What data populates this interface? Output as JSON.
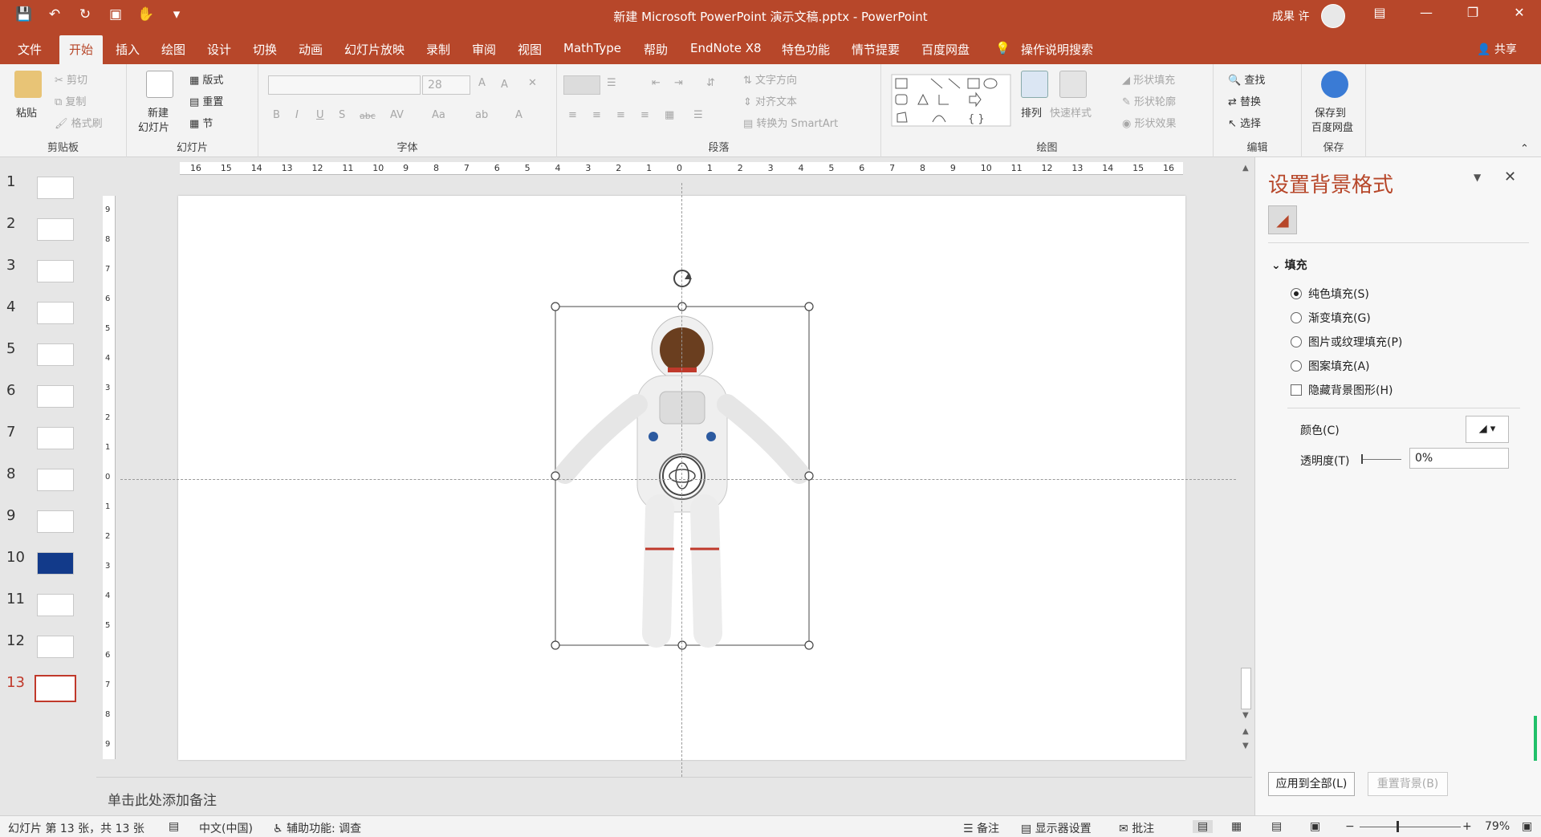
{
  "window": {
    "title": "新建 Microsoft PowerPoint 演示文稿.pptx  -  PowerPoint",
    "user": "成果 许",
    "titlebar_color": "#b7472a"
  },
  "qat": {
    "icons": [
      "save-icon",
      "undo-icon",
      "redo-icon",
      "present-icon",
      "touch-mode-icon",
      "customize-icon"
    ]
  },
  "tabs": [
    "文件",
    "开始",
    "插入",
    "绘图",
    "设计",
    "切换",
    "动画",
    "幻灯片放映",
    "录制",
    "审阅",
    "视图",
    "MathType",
    "帮助",
    "EndNote X8",
    "特色功能",
    "情节提要",
    "百度网盘",
    "操作说明搜索"
  ],
  "active_tab": "开始",
  "share_label": "共享",
  "ribbon": {
    "clipboard": {
      "paste": "粘贴",
      "cut": "剪切",
      "copy": "复制",
      "format_painter": "格式刷",
      "group": "剪贴板"
    },
    "slides": {
      "new_slide": "新建",
      "new_slide2": "幻灯片",
      "layout": "版式",
      "reset": "重置",
      "section": "节",
      "group": "幻灯片"
    },
    "font": {
      "font_name": "",
      "font_size": "28",
      "group": "字体",
      "bold": "B",
      "italic": "I",
      "underline": "U",
      "shadow": "S",
      "strike": "abc",
      "spacing": "AV",
      "case": "Aa",
      "color": "A",
      "grow": "A",
      "shrink": "A"
    },
    "paragraph": {
      "text_direction": "文字方向",
      "align_text": "对齐文本",
      "smartart": "转换为 SmartArt",
      "group": "段落"
    },
    "drawing": {
      "arrange": "排列",
      "quick_styles": "快速样式",
      "shape_fill": "形状填充",
      "shape_outline": "形状轮廓",
      "shape_effects": "形状效果",
      "group": "绘图"
    },
    "editing": {
      "find": "查找",
      "replace": "替换",
      "select": "选择",
      "group": "编辑"
    },
    "save": {
      "save_to": "保存到",
      "baidu": "百度网盘",
      "group": "保存"
    }
  },
  "slides": {
    "numbers": [
      "1",
      "2",
      "3",
      "4",
      "5",
      "6",
      "7",
      "8",
      "9",
      "10",
      "11",
      "12",
      "13"
    ],
    "selected": "13"
  },
  "ruler": {
    "h_labels": [
      "16",
      "15",
      "14",
      "13",
      "12",
      "11",
      "10",
      "9",
      "8",
      "7",
      "6",
      "5",
      "4",
      "3",
      "2",
      "1",
      "0",
      "1",
      "2",
      "3",
      "4",
      "5",
      "6",
      "7",
      "8",
      "9",
      "10",
      "11",
      "12",
      "13",
      "14",
      "15",
      "16"
    ],
    "v_labels": [
      "9",
      "8",
      "7",
      "6",
      "5",
      "4",
      "3",
      "2",
      "1",
      "0",
      "1",
      "2",
      "3",
      "4",
      "5",
      "6",
      "7",
      "8",
      "9"
    ]
  },
  "notes_placeholder": "单击此处添加备注",
  "format_pane": {
    "title": "设置背景格式",
    "section": "填充",
    "options": [
      "纯色填充(S)",
      "渐变填充(G)",
      "图片或纹理填充(P)",
      "图案填充(A)"
    ],
    "selected_option": "纯色填充(S)",
    "hide_bg_graphics": "隐藏背景图形(H)",
    "color_label": "颜色(C)",
    "transparency_label": "透明度(T)",
    "transparency_value": "0%",
    "apply_all": "应用到全部(L)",
    "reset_bg": "重置背景(B)"
  },
  "status": {
    "slide_info": "幻灯片 第 13 张，共 13 张",
    "language": "中文(中国)",
    "accessibility": "辅助功能: 调查",
    "notes": "备注",
    "display_settings": "显示器设置",
    "comments": "批注",
    "zoom": "79%"
  }
}
